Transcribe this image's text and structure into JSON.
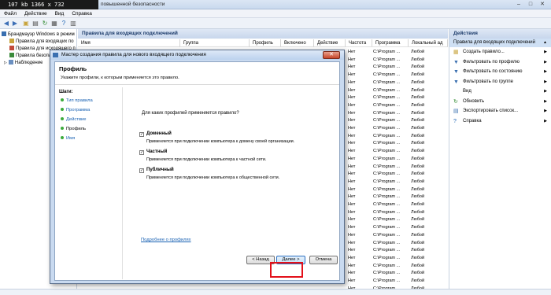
{
  "window": {
    "badge": "107 kb 1366 x 732",
    "title": "повышенной безопасности",
    "min": "–",
    "max": "□",
    "close": "✕"
  },
  "menu": [
    "Файл",
    "Действие",
    "Вид",
    "Справка"
  ],
  "tree": {
    "items": [
      {
        "label": "Брандмауэр Windows в режим"
      },
      {
        "label": "Правила для входящих по"
      },
      {
        "label": "Правила для исходящего п"
      },
      {
        "label": "Правила безопасно"
      },
      {
        "label": "Наблюдение"
      }
    ]
  },
  "center": {
    "title": "Правила для входящих подключений",
    "columns": [
      "Имя",
      "Группа",
      "Профиль",
      "Включено",
      "Действие",
      "Частота",
      "Программа",
      "Локальный ад"
    ],
    "rows": [
      {
        "c1": "Нет",
        "c2": "C:\\Program ...",
        "c3": "Любой"
      },
      {
        "c1": "Нет",
        "c2": "C:\\Program ...",
        "c3": "Любой"
      },
      {
        "c1": "Нет",
        "c2": "C:\\Program ...",
        "c3": "Любой"
      },
      {
        "c1": "Нет",
        "c2": "C:\\Program ...",
        "c3": "Любой"
      },
      {
        "c1": "Нет",
        "c2": "C:\\Program ...",
        "c3": "Любой"
      },
      {
        "c1": "Нет",
        "c2": "C:\\Program ...",
        "c3": "Любой"
      },
      {
        "c1": "Нет",
        "c2": "C:\\Program ...",
        "c3": "Любой"
      },
      {
        "c1": "Нет",
        "c2": "C:\\Program ...",
        "c3": "Любой"
      },
      {
        "c1": "Нет",
        "c2": "C:\\Program ...",
        "c3": "Любой"
      },
      {
        "c1": "Нет",
        "c2": "C:\\Program ...",
        "c3": "Любой"
      },
      {
        "c1": "Нет",
        "c2": "C:\\Program ...",
        "c3": "Любой"
      },
      {
        "c1": "Нет",
        "c2": "C:\\Program ...",
        "c3": "Любой"
      },
      {
        "c1": "Нет",
        "c2": "C:\\Program ...",
        "c3": "Любой"
      },
      {
        "c1": "Нет",
        "c2": "C:\\Program ...",
        "c3": "Любой"
      },
      {
        "c1": "Нет",
        "c2": "C:\\Program ...",
        "c3": "Любой"
      },
      {
        "c1": "Нет",
        "c2": "C:\\Program ...",
        "c3": "Любой"
      },
      {
        "c1": "Нет",
        "c2": "C:\\Program ...",
        "c3": "Любой"
      },
      {
        "c1": "Нет",
        "c2": "C:\\Program ...",
        "c3": "Любой"
      },
      {
        "c1": "Нет",
        "c2": "C:\\Program ...",
        "c3": "Любой"
      },
      {
        "c1": "Нет",
        "c2": "C:\\Program ...",
        "c3": "Любой"
      },
      {
        "c1": "Нет",
        "c2": "C:\\Program ...",
        "c3": "Любой"
      },
      {
        "c1": "Нет",
        "c2": "C:\\Program ...",
        "c3": "Любой"
      },
      {
        "c1": "Нет",
        "c2": "C:\\Program ...",
        "c3": "Любой"
      },
      {
        "c1": "Нет",
        "c2": "C:\\Program ...",
        "c3": "Любой"
      },
      {
        "c1": "Нет",
        "c2": "C:\\Program ...",
        "c3": "Любой"
      },
      {
        "c1": "Нет",
        "c2": "C:\\Program ...",
        "c3": "Любой"
      },
      {
        "c1": "Нет",
        "c2": "C:\\Program ...",
        "c3": "Любой"
      },
      {
        "c1": "Нет",
        "c2": "C:\\Program ...",
        "c3": "Любой"
      },
      {
        "c1": "Нет",
        "c2": "C:\\Program ...",
        "c3": "Любой"
      },
      {
        "c1": "Нет",
        "c2": "C:\\Program ...",
        "c3": "Любой"
      },
      {
        "c1": "Нет",
        "c2": "C:\\Program ...",
        "c3": "Любой"
      },
      {
        "c1": "Нет",
        "c2": "C:\\Program ...",
        "c3": "Любой"
      }
    ]
  },
  "actions": {
    "title": "Действия",
    "section": "Правила для входящих подключений",
    "items": [
      {
        "label": "Создать правило...",
        "icon": "new-rule-icon",
        "glyph": "▦",
        "color": "#c8a43c"
      },
      {
        "label": "Фильтровать по профилю",
        "icon": "filter-icon",
        "glyph": "▼",
        "color": "#3a6fb0"
      },
      {
        "label": "Фильтровать по состоянию",
        "icon": "filter-icon",
        "glyph": "▼",
        "color": "#3a6fb0"
      },
      {
        "label": "Фильтровать по группе",
        "icon": "filter-icon",
        "glyph": "▼",
        "color": "#3a6fb0"
      },
      {
        "label": "Вид",
        "icon": "",
        "glyph": "",
        "color": "#000"
      },
      {
        "label": "Обновить",
        "icon": "refresh-icon",
        "glyph": "↻",
        "color": "#2f8a2f"
      },
      {
        "label": "Экспортировать список...",
        "icon": "export-icon",
        "glyph": "▤",
        "color": "#3a6fb0"
      },
      {
        "label": "Справка",
        "icon": "help-icon",
        "glyph": "?",
        "color": "#1a62b3"
      }
    ]
  },
  "dialog": {
    "title": "Мастер создания правила для нового входящего подключения",
    "close": "✕",
    "heading": "Профиль",
    "subheading": "Укажите профили, к которым применяется это правило.",
    "steps_title": "Шаги:",
    "steps": [
      "Тип правила",
      "Программа",
      "Действие",
      "Профиль",
      "Имя"
    ],
    "question": "Для каких профилей применяется правило?",
    "options": [
      {
        "label": "Доменный",
        "desc": "Применяется при подключении компьютера к домену своей организации.",
        "checked": "✓"
      },
      {
        "label": "Частный",
        "desc": "Применяется при подключении компьютера к частной сети.",
        "checked": "✓"
      },
      {
        "label": "Публичный",
        "desc": "Применяется при подключении компьютера к общественной сети.",
        "checked": "✓"
      }
    ],
    "link": "Подробнее о профилях",
    "back": "< Назад",
    "next": "Далее >",
    "cancel": "Отмена"
  },
  "colors": {
    "highlight": "#e3101a",
    "accent": "#1a62b3"
  }
}
